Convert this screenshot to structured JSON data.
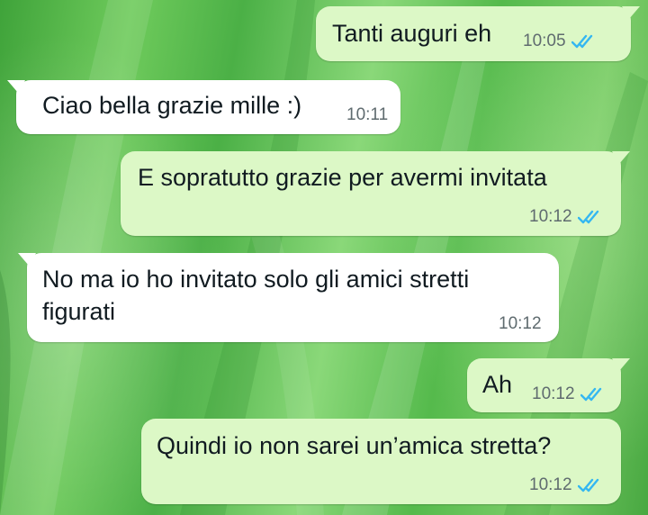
{
  "chat": {
    "colors": {
      "incoming_bubble": "#ffffff",
      "outgoing_bubble": "#dcf8c6",
      "read_ticks": "#34b7f1",
      "wallpaper": "#5fbf52"
    },
    "messages": [
      {
        "direction": "outgoing",
        "lines": [
          "Tanti auguri eh"
        ],
        "time": "10:05",
        "status": "read"
      },
      {
        "direction": "incoming",
        "lines": [
          "Ciao bella grazie mille :)"
        ],
        "time": "10:11"
      },
      {
        "direction": "outgoing",
        "lines": [
          "E sopratutto grazie per avermi invitata"
        ],
        "time": "10:12",
        "status": "read"
      },
      {
        "direction": "incoming",
        "lines": [
          "No ma io ho invitato solo gli amici stretti",
          "figurati"
        ],
        "time": "10:12"
      },
      {
        "direction": "outgoing",
        "lines": [
          "Ah"
        ],
        "time": "10:12",
        "status": "read"
      },
      {
        "direction": "outgoing",
        "lines": [
          "Quindi io non sarei un’amica stretta?"
        ],
        "time": "10:12",
        "status": "read"
      }
    ]
  }
}
